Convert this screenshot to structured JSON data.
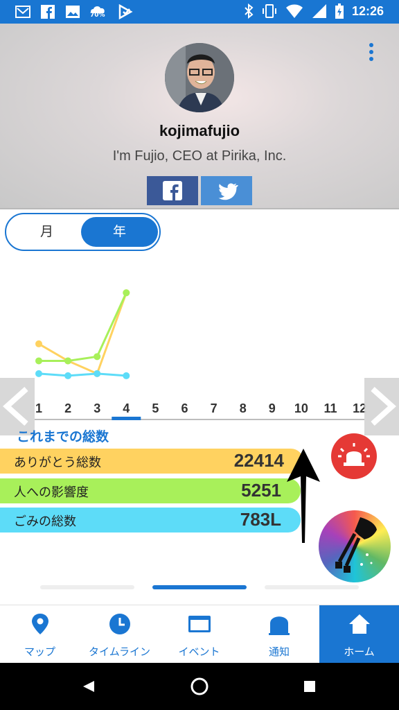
{
  "status_bar": {
    "battery_badge": "70%",
    "clock": "12:26",
    "left_icons": [
      "mail-icon",
      "facebook-icon",
      "image-icon",
      "weather-icon",
      "app-icon"
    ],
    "right_icons": [
      "bluetooth-icon",
      "vibrate-icon",
      "wifi-icon",
      "signal-icon",
      "battery-icon"
    ]
  },
  "profile": {
    "username": "kojimafujio",
    "bio": "I'm Fujio, CEO at Pirika, Inc."
  },
  "toggle": {
    "month_label": "月",
    "year_label": "年",
    "selected": "年"
  },
  "chart_data": {
    "type": "line",
    "x": [
      "1",
      "2",
      "3",
      "4",
      "5",
      "6",
      "7",
      "8",
      "9",
      "10",
      "11",
      "12"
    ],
    "selected_x": "4",
    "series": [
      {
        "color": "#ffd260",
        "values": [
          8,
          4,
          1,
          20
        ]
      },
      {
        "color": "#a8f05a",
        "values": [
          4,
          4,
          5,
          20
        ]
      },
      {
        "color": "#5ddcf8",
        "values": [
          1,
          0.5,
          1,
          0.5
        ]
      }
    ],
    "ylim": [
      0,
      22
    ],
    "grid": false
  },
  "totals": {
    "title": "これまでの総数",
    "items": [
      {
        "label": "ありがとう総数",
        "value": "22414",
        "color": "#ffd260"
      },
      {
        "label": "人への影響度",
        "value": "5251",
        "color": "#a8f05a"
      },
      {
        "label": "ごみの総数",
        "value": "783L",
        "color": "#5ddcf8"
      }
    ]
  },
  "bottom_nav": {
    "items": [
      {
        "label": "マップ",
        "icon": "map-pin-icon"
      },
      {
        "label": "タイムライン",
        "icon": "clock-icon"
      },
      {
        "label": "イベント",
        "icon": "event-card-icon"
      },
      {
        "label": "通知",
        "icon": "bell-icon"
      },
      {
        "label": "ホーム",
        "icon": "home-icon"
      }
    ],
    "active": "ホーム"
  },
  "colors": {
    "accent": "#1a76d2",
    "alarm": "#e53935"
  }
}
